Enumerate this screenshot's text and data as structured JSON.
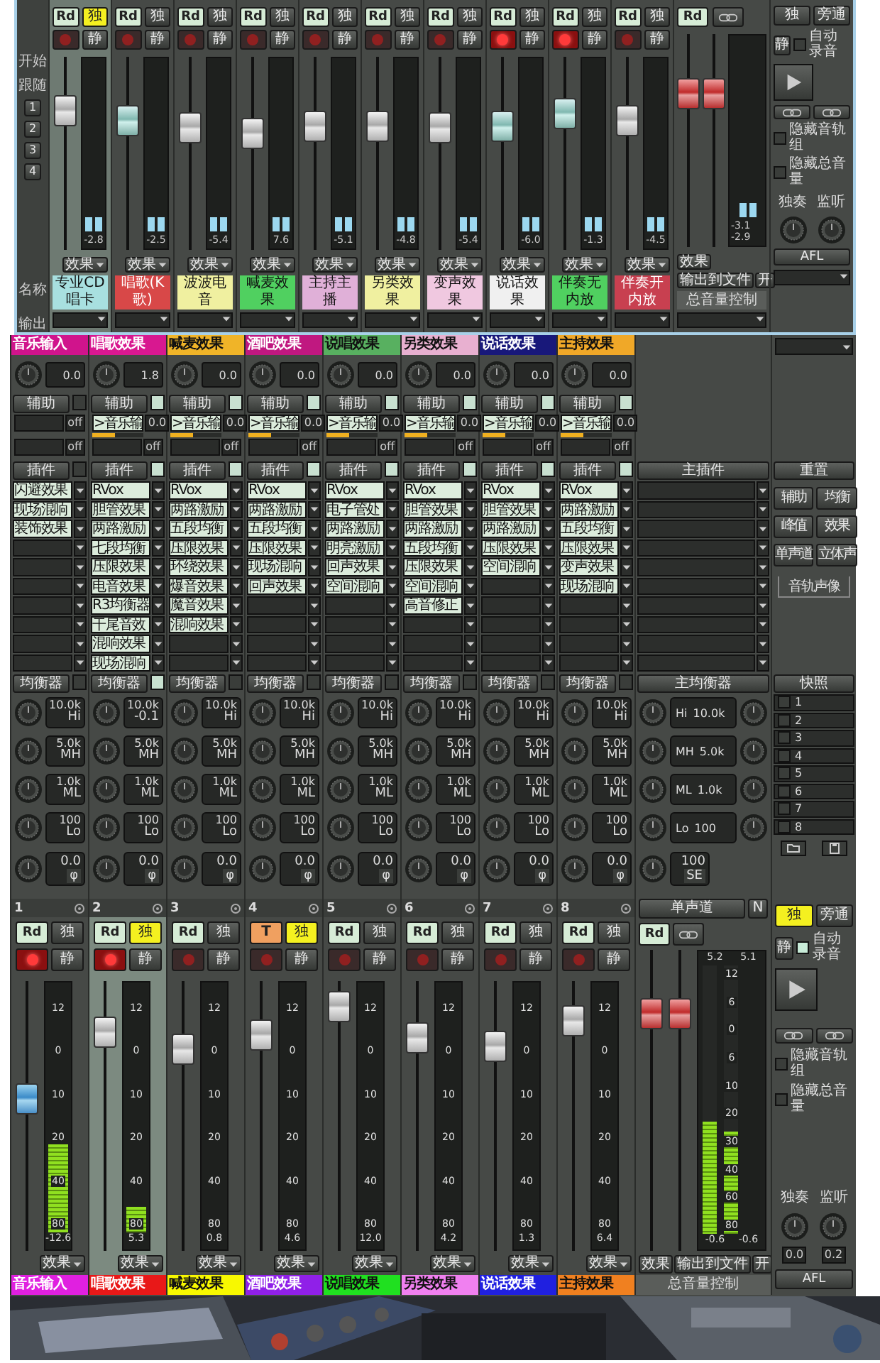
{
  "mini_mixer": {
    "side": {
      "start": "开始",
      "follow": "跟随",
      "groups": [
        "1",
        "2",
        "3",
        "4"
      ],
      "name_label": "名称",
      "output_label": "输出"
    },
    "channels": [
      {
        "mode": "Rd",
        "solo_label": "独",
        "solo": true,
        "armed": false,
        "mute_label": "静",
        "fader": {
          "level": 0.76
        },
        "meter": {
          "reading": "-2.8"
        },
        "fx": "效果",
        "name": "专业CD唱卡",
        "color": "#a8e0e0",
        "selected": true
      },
      {
        "mode": "Rd",
        "solo_label": "独",
        "solo": false,
        "armed": false,
        "mute_label": "静",
        "fader": {
          "level": 0.7
        },
        "meter": {
          "reading": "-2.5"
        },
        "fx": "效果",
        "name": "唱歌(K歌)",
        "color": "#d84848",
        "selected": false
      },
      {
        "mode": "Rd",
        "solo_label": "独",
        "solo": false,
        "armed": false,
        "mute_label": "静",
        "fader": {
          "level": 0.66
        },
        "meter": {
          "reading": "-5.4"
        },
        "fx": "效果",
        "name": "波波电音",
        "color": "#f0f0a0",
        "selected": false
      },
      {
        "mode": "Rd",
        "solo_label": "独",
        "solo": false,
        "armed": false,
        "mute_label": "静",
        "fader": {
          "level": 0.62
        },
        "meter": {
          "reading": "7.6"
        },
        "fx": "效果",
        "name": "喊麦效果",
        "color": "#50d060",
        "selected": false
      },
      {
        "mode": "Rd",
        "solo_label": "独",
        "solo": false,
        "armed": false,
        "mute_label": "静",
        "fader": {
          "level": 0.67
        },
        "meter": {
          "reading": "-5.1"
        },
        "fx": "效果",
        "name": "主持主播",
        "color": "#e0b0d8",
        "selected": false
      },
      {
        "mode": "Rd",
        "solo_label": "独",
        "solo": false,
        "armed": false,
        "mute_label": "静",
        "fader": {
          "level": 0.67
        },
        "meter": {
          "reading": "-4.8"
        },
        "fx": "效果",
        "name": "另类效果",
        "color": "#f0f0a0",
        "selected": false
      },
      {
        "mode": "Rd",
        "solo_label": "独",
        "solo": false,
        "armed": false,
        "mute_label": "静",
        "fader": {
          "level": 0.66
        },
        "meter": {
          "reading": "-5.4"
        },
        "fx": "效果",
        "name": "变声效果",
        "color": "#f0c8e0",
        "selected": false
      },
      {
        "mode": "Rd",
        "solo_label": "独",
        "solo": false,
        "armed": true,
        "mute_label": "静",
        "fader": {
          "level": 0.67
        },
        "meter": {
          "reading": "-6.0"
        },
        "fx": "效果",
        "name": "说话效果",
        "color": "#f0f0f0",
        "selected": false
      },
      {
        "mode": "Rd",
        "solo_label": "独",
        "solo": false,
        "armed": true,
        "mute_label": "静",
        "fader": {
          "level": 0.75
        },
        "meter": {
          "reading": "-1.3"
        },
        "fx": "效果",
        "name": "伴奏无内放",
        "color": "#50d060",
        "selected": false
      },
      {
        "mode": "Rd",
        "solo_label": "独",
        "solo": false,
        "armed": false,
        "mute_label": "静",
        "fader": {
          "level": 0.7
        },
        "meter": {
          "reading": "-4.5"
        },
        "fx": "效果",
        "name": "伴奏开内放",
        "color": "#c84050",
        "selected": false
      }
    ],
    "master": {
      "mode": "Rd",
      "faders": [
        {
          "level": 0.76
        },
        {
          "level": 0.76
        }
      ],
      "readings": [
        "-3.1",
        "-2.9"
      ],
      "fx": "效果",
      "export": "输出到文件",
      "open": "开",
      "name": "总音量控制"
    },
    "controls": {
      "solo": "独",
      "solo_on": false,
      "bypass": "旁通",
      "mute": "静",
      "auto_record": "自动录音",
      "auto_record_checked": false,
      "hide_tracks": "隐藏音轨组",
      "hide_tracks_checked": false,
      "hide_master": "隐藏总音量",
      "hide_master_checked": false,
      "solo_knob": "独奏",
      "monitor_knob": "监听",
      "afl": "AFL"
    }
  },
  "main_mixer": {
    "channels": [
      {
        "tab": {
          "label": "音乐输入",
          "color": "#d0148c"
        },
        "pan": "0.0",
        "aux_header": "辅助",
        "aux_on": false,
        "sends": [
          {
            "value": "off"
          },
          {
            "value": "off"
          }
        ],
        "insert_header": "插件",
        "insert_on": false,
        "inserts": [
          "闪避效果",
          "现场混响",
          "装饰效果"
        ],
        "eq_header": "均衡器",
        "eq_on": false,
        "eq_bands": [
          {
            "value": "10.0k",
            "label": "Hi"
          },
          {
            "value": "5.0k",
            "label": "MH"
          },
          {
            "value": "1.0k",
            "label": "ML"
          },
          {
            "value": "100",
            "label": "Lo"
          }
        ],
        "gain": "0.0",
        "phase": "φ",
        "number": "1",
        "mode": "Rd",
        "mode_on": false,
        "solo_label": "独",
        "solo": false,
        "armed": true,
        "mute_label": "静",
        "fader": {
          "level": 0.57
        },
        "meter": {
          "level": 0.35,
          "scale": [
            "12",
            "0",
            "10",
            "20",
            "40",
            "80"
          ],
          "reading": "-12.6"
        },
        "fx": "效果",
        "name": {
          "label": "音乐输入",
          "color": "#e020e0"
        },
        "selected": false
      },
      {
        "tab": {
          "label": "唱歌效果",
          "color": "#d81890"
        },
        "pan": "1.8",
        "aux_header": "辅助",
        "aux_on": true,
        "sends": [
          {
            "target": ">音乐输",
            "value": "0.0",
            "level": 0.45
          },
          {
            "value": "off"
          }
        ],
        "insert_header": "插件",
        "insert_on": true,
        "inserts": [
          "RVox",
          "胆管效果",
          "两路激励",
          "七段均衡",
          "压限效果",
          "电音效果",
          "R3均衡器",
          "干尾音效",
          "混响效果",
          "现场混响"
        ],
        "eq_header": "均衡器",
        "eq_on": true,
        "eq_bands": [
          {
            "value": "10.0k",
            "label": "-0.1"
          },
          {
            "value": "5.0k",
            "label": "MH"
          },
          {
            "value": "1.0k",
            "label": "ML"
          },
          {
            "value": "100",
            "label": "Lo"
          }
        ],
        "gain": "0.0",
        "phase": "φ",
        "number": "2",
        "mode": "Rd",
        "mode_on": false,
        "solo_label": "独",
        "solo": true,
        "armed": true,
        "mute_label": "静",
        "fader": {
          "level": 0.85
        },
        "meter": {
          "level": 0.1,
          "scale": [
            "12",
            "0",
            "10",
            "20",
            "40",
            "80"
          ],
          "reading": "5.3"
        },
        "fx": "效果",
        "name": {
          "label": "唱歌效果",
          "color": "#e81818"
        },
        "selected": true
      },
      {
        "tab": {
          "label": "喊麦效果",
          "color": "#f0b428"
        },
        "pan": "0.0",
        "aux_header": "辅助",
        "aux_on": true,
        "sends": [
          {
            "target": ">音乐输",
            "value": "0.0",
            "level": 0.45
          },
          {
            "value": "off"
          }
        ],
        "insert_header": "插件",
        "insert_on": true,
        "inserts": [
          "RVox",
          "两路激励",
          "五段均衡",
          "压限效果",
          "环绕效果",
          "爆音效果",
          "魔音效果",
          "混响效果"
        ],
        "eq_header": "均衡器",
        "eq_on": false,
        "eq_bands": [
          {
            "value": "10.0k",
            "label": "Hi"
          },
          {
            "value": "5.0k",
            "label": "MH"
          },
          {
            "value": "1.0k",
            "label": "ML"
          },
          {
            "value": "100",
            "label": "Lo"
          }
        ],
        "gain": "0.0",
        "phase": "φ",
        "number": "3",
        "mode": "Rd",
        "mode_on": false,
        "solo_label": "独",
        "solo": false,
        "armed": false,
        "mute_label": "静",
        "fader": {
          "level": 0.78
        },
        "meter": {
          "scale": [
            "12",
            "0",
            "10",
            "20",
            "40",
            "80"
          ],
          "reading": "0.8"
        },
        "fx": "效果",
        "name": {
          "label": "喊麦效果",
          "color": "#f8f800"
        },
        "selected": false
      },
      {
        "tab": {
          "label": "酒吧效果",
          "color": "#c01880"
        },
        "pan": "0.0",
        "aux_header": "辅助",
        "aux_on": true,
        "sends": [
          {
            "target": ">音乐输",
            "value": "0.0",
            "level": 0.45
          },
          {
            "value": "off"
          }
        ],
        "insert_header": "插件",
        "insert_on": true,
        "inserts": [
          "RVox",
          "两路激励",
          "五段均衡",
          "压限效果",
          "现场混响",
          "回声效果"
        ],
        "eq_header": "均衡器",
        "eq_on": false,
        "eq_bands": [
          {
            "value": "10.0k",
            "label": "Hi"
          },
          {
            "value": "5.0k",
            "label": "MH"
          },
          {
            "value": "1.0k",
            "label": "ML"
          },
          {
            "value": "100",
            "label": "Lo"
          }
        ],
        "gain": "0.0",
        "phase": "φ",
        "number": "4",
        "mode": "T",
        "mode_on": true,
        "solo_label": "独",
        "solo": true,
        "armed": false,
        "mute_label": "静",
        "fader": {
          "level": 0.84
        },
        "meter": {
          "scale": [
            "12",
            "0",
            "10",
            "20",
            "40",
            "80"
          ],
          "reading": "4.6"
        },
        "fx": "效果",
        "name": {
          "label": "酒吧效果",
          "color": "#9020e8"
        },
        "selected": false
      },
      {
        "tab": {
          "label": "说唱效果",
          "color": "#58b060"
        },
        "pan": "0.0",
        "aux_header": "辅助",
        "aux_on": true,
        "sends": [
          {
            "target": ">音乐输",
            "value": "0.0",
            "level": 0.45
          },
          {
            "value": "off"
          }
        ],
        "insert_header": "插件",
        "insert_on": true,
        "inserts": [
          "RVox",
          "电子管处",
          "两路激励",
          "明亮激励",
          "回声效果",
          "空间混响"
        ],
        "eq_header": "均衡器",
        "eq_on": false,
        "eq_bands": [
          {
            "value": "10.0k",
            "label": "Hi"
          },
          {
            "value": "5.0k",
            "label": "MH"
          },
          {
            "value": "1.0k",
            "label": "ML"
          },
          {
            "value": "100",
            "label": "Lo"
          }
        ],
        "gain": "0.0",
        "phase": "φ",
        "number": "5",
        "mode": "Rd",
        "mode_on": false,
        "solo_label": "独",
        "solo": false,
        "armed": false,
        "mute_label": "静",
        "fader": {
          "level": 0.96
        },
        "meter": {
          "scale": [
            "12",
            "0",
            "10",
            "20",
            "40",
            "80"
          ],
          "reading": "12.0"
        },
        "fx": "效果",
        "name": {
          "label": "说唱效果",
          "color": "#20e020"
        },
        "selected": false
      },
      {
        "tab": {
          "label": "另类效果",
          "color": "#e8b0d0"
        },
        "pan": "0.0",
        "aux_header": "辅助",
        "aux_on": true,
        "sends": [
          {
            "target": ">音乐输",
            "value": "0.0",
            "level": 0.45
          },
          {
            "value": "off"
          }
        ],
        "insert_header": "插件",
        "insert_on": true,
        "inserts": [
          "RVox",
          "胆管效果",
          "两路激励",
          "五段均衡",
          "压限效果",
          "空间混响",
          "高音修正"
        ],
        "eq_header": "均衡器",
        "eq_on": false,
        "eq_bands": [
          {
            "value": "10.0k",
            "label": "Hi"
          },
          {
            "value": "5.0k",
            "label": "MH"
          },
          {
            "value": "1.0k",
            "label": "ML"
          },
          {
            "value": "100",
            "label": "Lo"
          }
        ],
        "gain": "0.0",
        "phase": "φ",
        "number": "6",
        "mode": "Rd",
        "mode_on": false,
        "solo_label": "独",
        "solo": false,
        "armed": false,
        "mute_label": "静",
        "fader": {
          "level": 0.83
        },
        "meter": {
          "scale": [
            "12",
            "0",
            "10",
            "20",
            "40",
            "80"
          ],
          "reading": "4.2"
        },
        "fx": "效果",
        "name": {
          "label": "另类效果",
          "color": "#f080f0"
        },
        "selected": false
      },
      {
        "tab": {
          "label": "说话效果",
          "color": "#18187a"
        },
        "pan": "0.0",
        "aux_header": "辅助",
        "aux_on": true,
        "sends": [
          {
            "target": ">音乐输",
            "value": "0.0",
            "level": 0.45
          },
          {
            "value": "off"
          }
        ],
        "insert_header": "插件",
        "insert_on": true,
        "inserts": [
          "RVox",
          "胆管效果",
          "两路激励",
          "压限效果",
          "空间混响"
        ],
        "eq_header": "均衡器",
        "eq_on": false,
        "eq_bands": [
          {
            "value": "10.0k",
            "label": "Hi"
          },
          {
            "value": "5.0k",
            "label": "MH"
          },
          {
            "value": "1.0k",
            "label": "ML"
          },
          {
            "value": "100",
            "label": "Lo"
          }
        ],
        "gain": "0.0",
        "phase": "φ",
        "number": "7",
        "mode": "Rd",
        "mode_on": false,
        "solo_label": "独",
        "solo": false,
        "armed": false,
        "mute_label": "静",
        "fader": {
          "level": 0.79
        },
        "meter": {
          "scale": [
            "12",
            "0",
            "10",
            "20",
            "40",
            "80"
          ],
          "reading": "1.3"
        },
        "fx": "效果",
        "name": {
          "label": "说话效果",
          "color": "#2020e0"
        },
        "selected": false
      },
      {
        "tab": {
          "label": "主持效果",
          "color": "#f0a828"
        },
        "pan": "0.0",
        "aux_header": "辅助",
        "aux_on": true,
        "sends": [
          {
            "target": ">音乐输",
            "value": "0.0",
            "level": 0.45
          },
          {
            "value": "off"
          }
        ],
        "insert_header": "插件",
        "insert_on": true,
        "inserts": [
          "RVox",
          "两路激励",
          "五段均衡",
          "压限效果",
          "变声效果",
          "现场混响"
        ],
        "eq_header": "均衡器",
        "eq_on": false,
        "eq_bands": [
          {
            "value": "10.0k",
            "label": "Hi"
          },
          {
            "value": "5.0k",
            "label": "MH"
          },
          {
            "value": "1.0k",
            "label": "ML"
          },
          {
            "value": "100",
            "label": "Lo"
          }
        ],
        "gain": "0.0",
        "phase": "φ",
        "number": "8",
        "mode": "Rd",
        "mode_on": false,
        "solo_label": "独",
        "solo": false,
        "armed": false,
        "mute_label": "静",
        "fader": {
          "level": 0.9
        },
        "meter": {
          "scale": [
            "12",
            "0",
            "10",
            "20",
            "40",
            "80"
          ],
          "reading": "6.4"
        },
        "fx": "效果",
        "name": {
          "label": "主持效果",
          "color": "#f08020"
        },
        "selected": false
      }
    ],
    "master": {
      "insert_header": "主插件",
      "eq_header": "主均衡器",
      "eq_bands": [
        {
          "label": "Hi",
          "value": "10.0k"
        },
        {
          "label": "MH",
          "value": "5.0k"
        },
        {
          "label": "ML",
          "value": "1.0k"
        },
        {
          "label": "Lo",
          "value": "100"
        }
      ],
      "width_value": "100",
      "width_label": "SE",
      "mono": "单声道",
      "n_label": "N",
      "mode": "Rd",
      "faders": [
        {
          "level": 0.82
        },
        {
          "level": 0.82
        }
      ],
      "meter": {
        "labels": [
          "5.2",
          "5.1"
        ],
        "scale": [
          "12",
          "6",
          "0",
          "6",
          "10",
          "20",
          "30",
          "40",
          "60",
          "80"
        ],
        "levels": [
          {
            "level": 0.42
          },
          {
            "level": 0.38
          }
        ],
        "readings": [
          "-0.6",
          "-0.6"
        ]
      },
      "fx": "效果",
      "export": "输出到文件",
      "open": "开",
      "name": "总音量控制"
    },
    "reset": {
      "header": "重置",
      "buttons": [
        "辅助",
        "均衡",
        "峰值",
        "效果",
        "单声道",
        "立体声"
      ],
      "caption": "音轨声像"
    },
    "snapshots": {
      "header": "快照",
      "items": [
        {
          "label": "1",
          "checked": false
        },
        {
          "label": "2",
          "checked": false
        },
        {
          "label": "3",
          "checked": false
        },
        {
          "label": "4",
          "checked": false
        },
        {
          "label": "5",
          "checked": false
        },
        {
          "label": "6",
          "checked": false
        },
        {
          "label": "7",
          "checked": false
        },
        {
          "label": "8",
          "checked": false
        }
      ]
    },
    "controls": {
      "solo": "独",
      "solo_on": true,
      "bypass": "旁通",
      "mute": "静",
      "auto_record": "自动录音",
      "auto_record_checked": true,
      "hide_tracks": "隐藏音轨组",
      "hide_tracks_checked": false,
      "hide_master": "隐藏总音量",
      "hide_master_checked": false,
      "solo_knob": "独奏",
      "monitor_knob": "监听",
      "solo_value": "0.0",
      "monitor_value": "0.2",
      "afl": "AFL"
    }
  }
}
